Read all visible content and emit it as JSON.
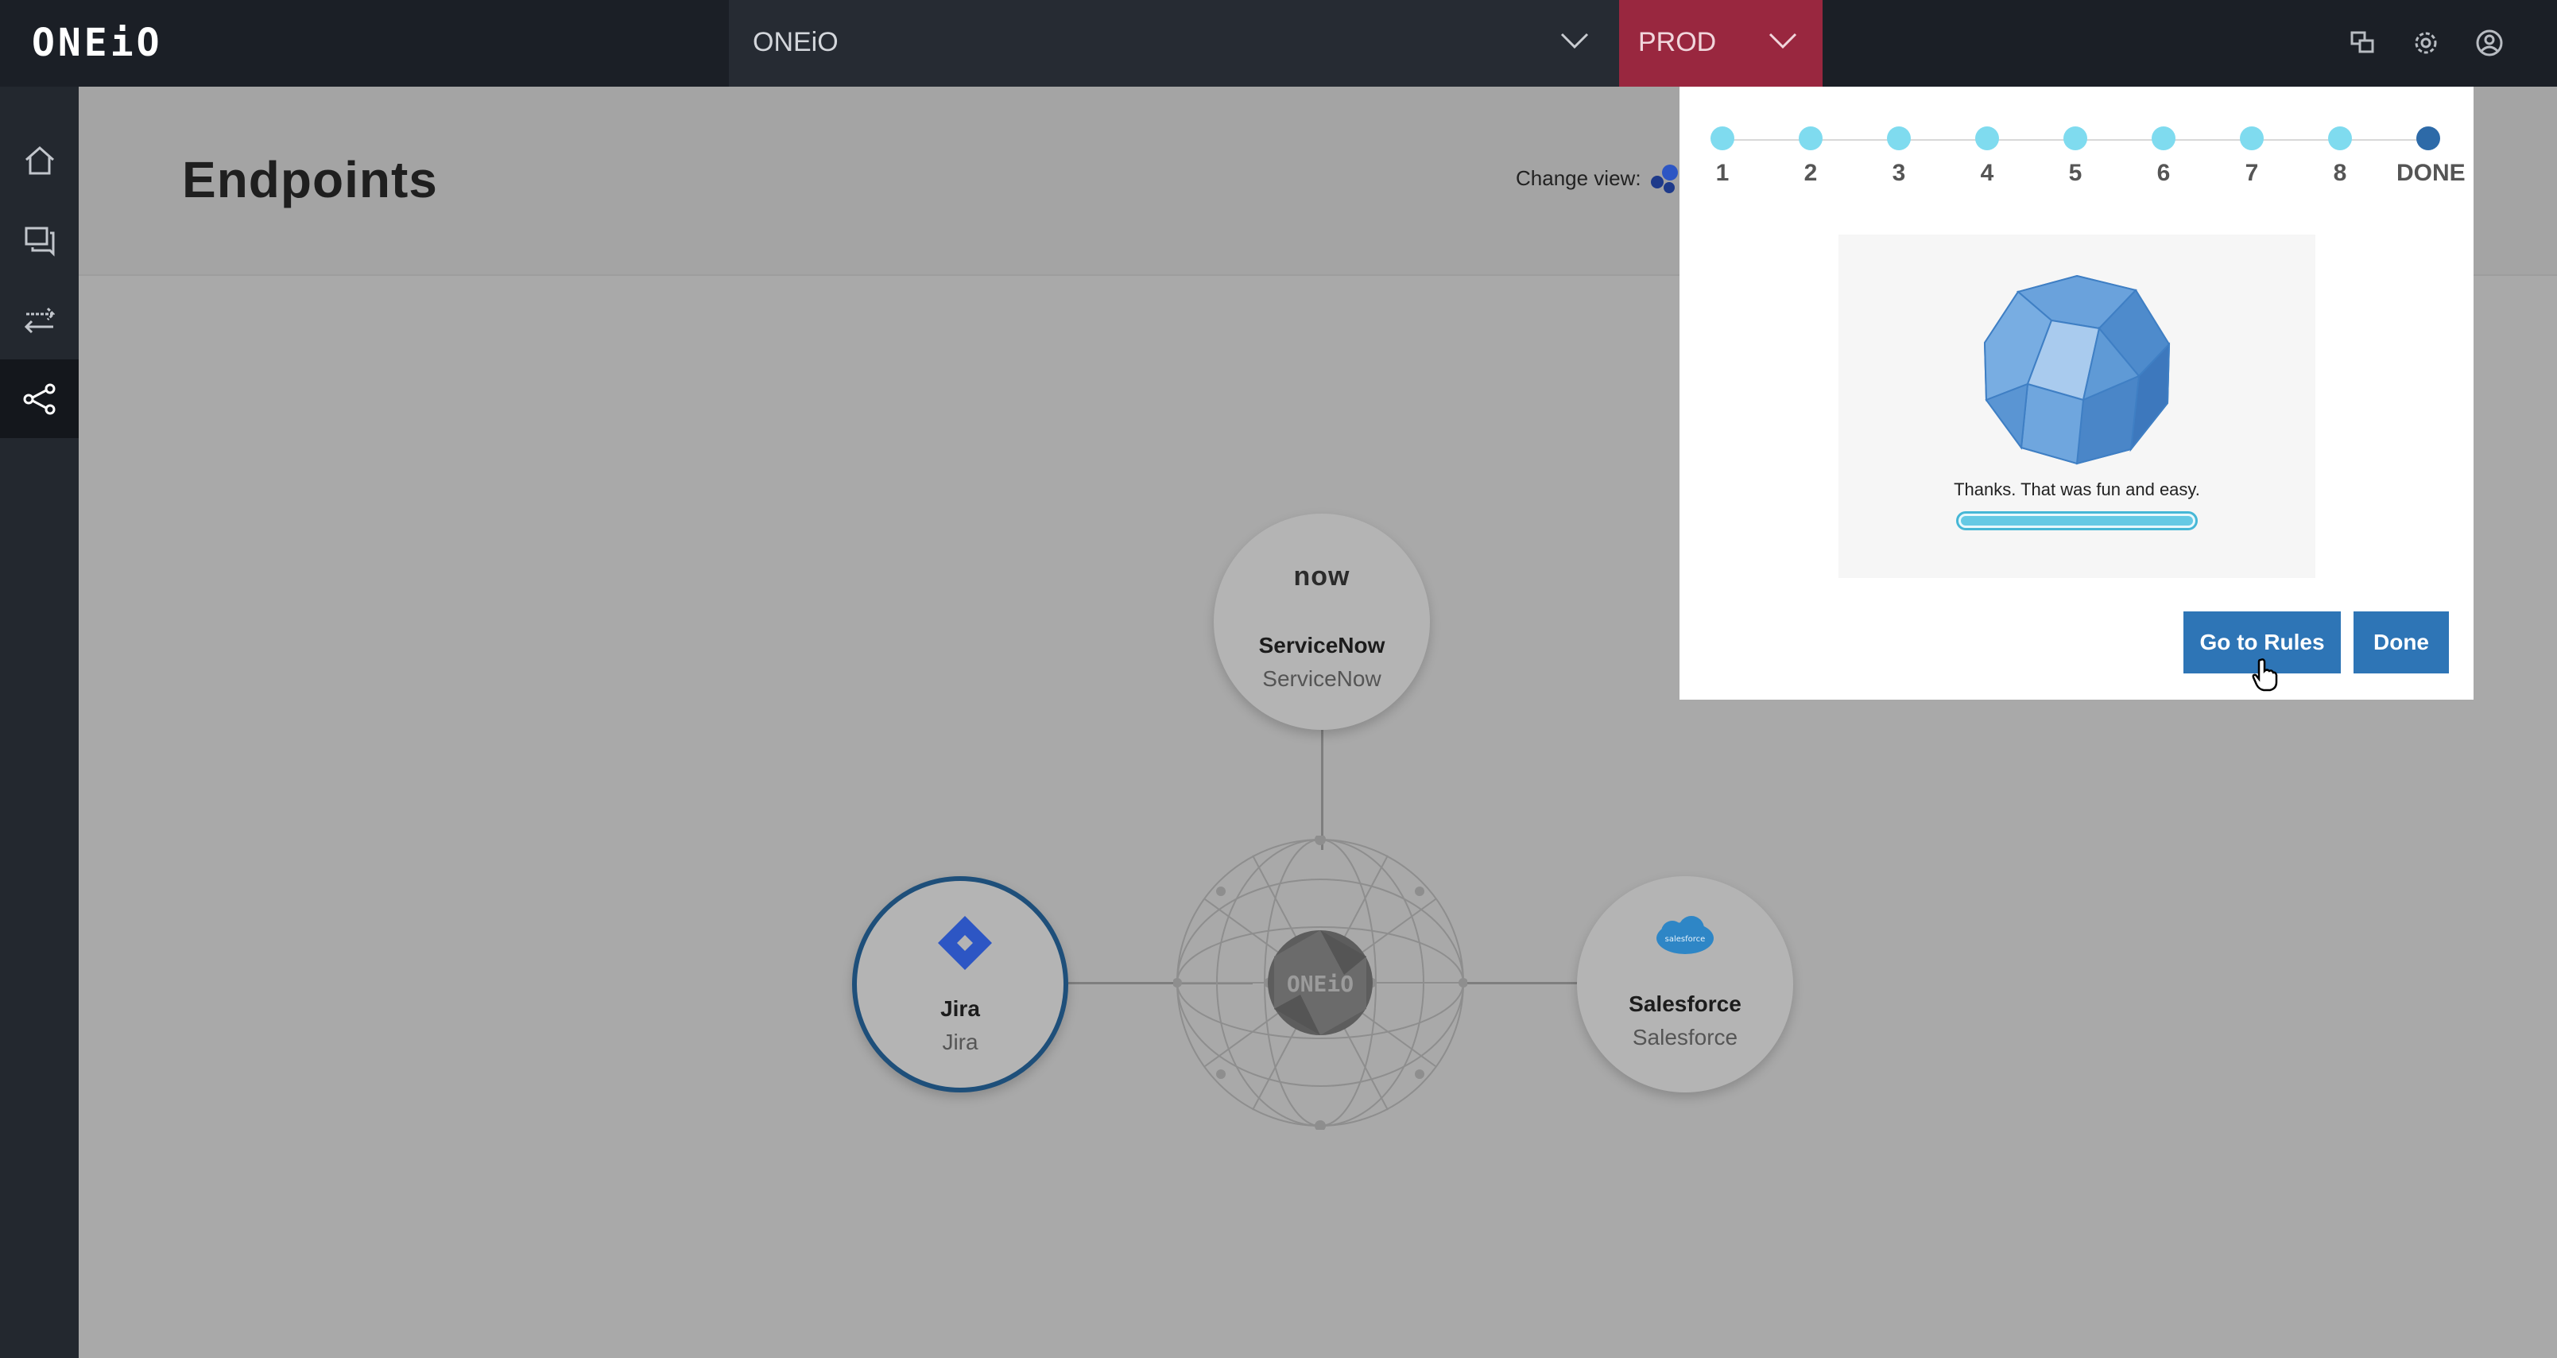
{
  "app": {
    "logo": "ONEiO"
  },
  "topbar": {
    "organization": {
      "value": "ONEiO",
      "icon": "chevron-down-icon"
    },
    "environment": {
      "value": "PROD",
      "icon": "chevron-down-icon",
      "color": "#99273f"
    },
    "icons": [
      "windows-icon",
      "gear-icon",
      "user-profile-icon"
    ]
  },
  "sidebar": {
    "items": [
      {
        "name": "home",
        "icon": "home-icon",
        "active": false
      },
      {
        "name": "messages",
        "icon": "chat-bubbles-icon",
        "active": false
      },
      {
        "name": "rules",
        "icon": "arrows-exchange-icon",
        "active": false
      },
      {
        "name": "endpoints",
        "icon": "share-nodes-icon",
        "active": true
      }
    ]
  },
  "main": {
    "title": "Endpoints",
    "change_view_label": "Change view:"
  },
  "graph": {
    "hub_label": "ONEiO",
    "nodes": [
      {
        "logo": "now",
        "name": "ServiceNow",
        "type": "ServiceNow",
        "selected": false
      },
      {
        "logo": "jira-icon",
        "name": "Jira",
        "type": "Jira",
        "selected": true
      },
      {
        "logo": "salesforce",
        "name": "Salesforce",
        "type": "Salesforce",
        "selected": false
      }
    ]
  },
  "wizard": {
    "steps": [
      "1",
      "2",
      "3",
      "4",
      "5",
      "6",
      "7",
      "8",
      "DONE"
    ],
    "current_step": "DONE",
    "message": "Thanks. That was fun and easy.",
    "progress": 1.0,
    "buttons": {
      "go_to_rules": "Go to Rules",
      "done": "Done"
    },
    "accent_color": "#2e75b6"
  }
}
